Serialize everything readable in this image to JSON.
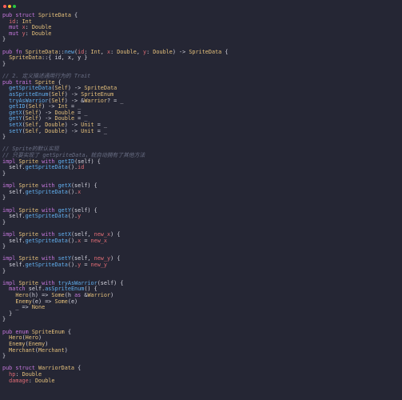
{
  "window": {
    "controls": {
      "close_color": "#ff5f57",
      "minimize_color": "#febc2e",
      "maximize_color": "#28c840"
    }
  },
  "code_lines": [
    [
      [
        "kw",
        "pub struct "
      ],
      [
        "ty",
        "SpriteData"
      ],
      [
        "pl",
        " {"
      ]
    ],
    [
      [
        "pr",
        "  id"
      ],
      [
        "pl",
        ": "
      ],
      [
        "ty",
        "Int"
      ]
    ],
    [
      [
        "kw",
        "  mut "
      ],
      [
        "pr",
        "x"
      ],
      [
        "pl",
        ": "
      ],
      [
        "ty",
        "Double"
      ]
    ],
    [
      [
        "kw",
        "  mut "
      ],
      [
        "pr",
        "y"
      ],
      [
        "pl",
        ": "
      ],
      [
        "ty",
        "Double"
      ]
    ],
    [
      [
        "pl",
        "}"
      ]
    ],
    [],
    [
      [
        "kw",
        "pub fn "
      ],
      [
        "ty",
        "SpriteData"
      ],
      [
        "pl",
        "::"
      ],
      [
        "fn",
        "new"
      ],
      [
        "pl",
        "("
      ],
      [
        "pr",
        "id"
      ],
      [
        "pl",
        ": "
      ],
      [
        "ty",
        "Int"
      ],
      [
        "pl",
        ", "
      ],
      [
        "pr",
        "x"
      ],
      [
        "pl",
        ": "
      ],
      [
        "ty",
        "Double"
      ],
      [
        "pl",
        ", "
      ],
      [
        "pr",
        "y"
      ],
      [
        "pl",
        ": "
      ],
      [
        "ty",
        "Double"
      ],
      [
        "pl",
        ") -> "
      ],
      [
        "ty",
        "SpriteData"
      ],
      [
        "pl",
        " {"
      ]
    ],
    [
      [
        "pl",
        "  "
      ],
      [
        "ty",
        "SpriteData"
      ],
      [
        "pl",
        "::{ id, x, y }"
      ]
    ],
    [
      [
        "pl",
        "}"
      ]
    ],
    [],
    [
      [
        "cm",
        "// 2. 定义描述通用行为的 Trait"
      ]
    ],
    [
      [
        "kw",
        "pub trait "
      ],
      [
        "ty",
        "Sprite"
      ],
      [
        "pl",
        " {"
      ]
    ],
    [
      [
        "fn",
        "  getSpriteData"
      ],
      [
        "pl",
        "("
      ],
      [
        "ty",
        "Self"
      ],
      [
        "pl",
        ") -> "
      ],
      [
        "ty",
        "SpriteData"
      ]
    ],
    [
      [
        "fn",
        "  asSpriteEnum"
      ],
      [
        "pl",
        "("
      ],
      [
        "ty",
        "Self"
      ],
      [
        "pl",
        ") -> "
      ],
      [
        "ty",
        "SpriteEnum"
      ]
    ],
    [
      [
        "fn",
        "  tryAsWarrior"
      ],
      [
        "pl",
        "("
      ],
      [
        "ty",
        "Self"
      ],
      [
        "pl",
        ") -> &"
      ],
      [
        "ty",
        "Warrior"
      ],
      [
        "pl",
        "? = _"
      ]
    ],
    [
      [
        "fn",
        "  getID"
      ],
      [
        "pl",
        "("
      ],
      [
        "ty",
        "Self"
      ],
      [
        "pl",
        ") -> "
      ],
      [
        "ty",
        "Int"
      ],
      [
        "pl",
        " = _"
      ]
    ],
    [
      [
        "fn",
        "  getX"
      ],
      [
        "pl",
        "("
      ],
      [
        "ty",
        "Self"
      ],
      [
        "pl",
        ") -> "
      ],
      [
        "ty",
        "Double"
      ],
      [
        "pl",
        " = _"
      ]
    ],
    [
      [
        "fn",
        "  getY"
      ],
      [
        "pl",
        "("
      ],
      [
        "ty",
        "Self"
      ],
      [
        "pl",
        ") -> "
      ],
      [
        "ty",
        "Double"
      ],
      [
        "pl",
        " = _"
      ]
    ],
    [
      [
        "fn",
        "  setX"
      ],
      [
        "pl",
        "("
      ],
      [
        "ty",
        "Self"
      ],
      [
        "pl",
        ", "
      ],
      [
        "ty",
        "Double"
      ],
      [
        "pl",
        ") -> "
      ],
      [
        "ty",
        "Unit"
      ],
      [
        "pl",
        " = _"
      ]
    ],
    [
      [
        "fn",
        "  setY"
      ],
      [
        "pl",
        "("
      ],
      [
        "ty",
        "Self"
      ],
      [
        "pl",
        ", "
      ],
      [
        "ty",
        "Double"
      ],
      [
        "pl",
        ") -> "
      ],
      [
        "ty",
        "Unit"
      ],
      [
        "pl",
        " = _"
      ]
    ],
    [
      [
        "pl",
        "}"
      ]
    ],
    [],
    [
      [
        "cm",
        "// Sprite的默认实现"
      ]
    ],
    [
      [
        "cm",
        "// 只要实现了 getSpriteData，就自动拥有了其他方法"
      ]
    ],
    [
      [
        "kw",
        "impl "
      ],
      [
        "ty",
        "Sprite"
      ],
      [
        "kw",
        " with "
      ],
      [
        "fn",
        "getID"
      ],
      [
        "pl",
        "(self) {"
      ]
    ],
    [
      [
        "pl",
        "  self."
      ],
      [
        "fn",
        "getSpriteData"
      ],
      [
        "pl",
        "()."
      ],
      [
        "pr",
        "id"
      ]
    ],
    [
      [
        "pl",
        "}"
      ]
    ],
    [],
    [
      [
        "kw",
        "impl "
      ],
      [
        "ty",
        "Sprite"
      ],
      [
        "kw",
        " with "
      ],
      [
        "fn",
        "getX"
      ],
      [
        "pl",
        "(self) {"
      ]
    ],
    [
      [
        "pl",
        "  self."
      ],
      [
        "fn",
        "getSpriteData"
      ],
      [
        "pl",
        "()."
      ],
      [
        "pr",
        "x"
      ]
    ],
    [
      [
        "pl",
        "}"
      ]
    ],
    [],
    [
      [
        "kw",
        "impl "
      ],
      [
        "ty",
        "Sprite"
      ],
      [
        "kw",
        " with "
      ],
      [
        "fn",
        "getY"
      ],
      [
        "pl",
        "(self) {"
      ]
    ],
    [
      [
        "pl",
        "  self."
      ],
      [
        "fn",
        "getSpriteData"
      ],
      [
        "pl",
        "()."
      ],
      [
        "pr",
        "y"
      ]
    ],
    [
      [
        "pl",
        "}"
      ]
    ],
    [],
    [
      [
        "kw",
        "impl "
      ],
      [
        "ty",
        "Sprite"
      ],
      [
        "kw",
        " with "
      ],
      [
        "fn",
        "setX"
      ],
      [
        "pl",
        "(self, "
      ],
      [
        "pr",
        "new_x"
      ],
      [
        "pl",
        ") {"
      ]
    ],
    [
      [
        "pl",
        "  self."
      ],
      [
        "fn",
        "getSpriteData"
      ],
      [
        "pl",
        "()."
      ],
      [
        "pr",
        "x"
      ],
      [
        "pl",
        " = "
      ],
      [
        "pr",
        "new_x"
      ]
    ],
    [
      [
        "pl",
        "}"
      ]
    ],
    [],
    [
      [
        "kw",
        "impl "
      ],
      [
        "ty",
        "Sprite"
      ],
      [
        "kw",
        " with "
      ],
      [
        "fn",
        "setY"
      ],
      [
        "pl",
        "(self, "
      ],
      [
        "pr",
        "new_y"
      ],
      [
        "pl",
        ") {"
      ]
    ],
    [
      [
        "pl",
        "  self."
      ],
      [
        "fn",
        "getSpriteData"
      ],
      [
        "pl",
        "()."
      ],
      [
        "pr",
        "y"
      ],
      [
        "pl",
        " = "
      ],
      [
        "pr",
        "new_y"
      ]
    ],
    [
      [
        "pl",
        "}"
      ]
    ],
    [],
    [
      [
        "kw",
        "impl "
      ],
      [
        "ty",
        "Sprite"
      ],
      [
        "kw",
        " with "
      ],
      [
        "fn",
        "tryAsWarrior"
      ],
      [
        "pl",
        "(self) {"
      ]
    ],
    [
      [
        "kw",
        "  match "
      ],
      [
        "pl",
        "self."
      ],
      [
        "fn",
        "asSpriteEnum"
      ],
      [
        "pl",
        "() {"
      ]
    ],
    [
      [
        "ty",
        "    Hero"
      ],
      [
        "pl",
        "(h) => "
      ],
      [
        "ty",
        "Some"
      ],
      [
        "pl",
        "(h "
      ],
      [
        "kw",
        "as"
      ],
      [
        "pl",
        " &"
      ],
      [
        "ty",
        "Warrior"
      ],
      [
        "pl",
        ")"
      ]
    ],
    [
      [
        "ty",
        "    Enemy"
      ],
      [
        "pl",
        "(e) => "
      ],
      [
        "ty",
        "Some"
      ],
      [
        "pl",
        "(e)"
      ]
    ],
    [
      [
        "pl",
        "    _ => "
      ],
      [
        "ty",
        "None"
      ]
    ],
    [
      [
        "pl",
        "  }"
      ]
    ],
    [
      [
        "pl",
        "}"
      ]
    ],
    [],
    [
      [
        "kw",
        "pub enum "
      ],
      [
        "ty",
        "SpriteEnum"
      ],
      [
        "pl",
        " {"
      ]
    ],
    [
      [
        "ty",
        "  Hero"
      ],
      [
        "pl",
        "("
      ],
      [
        "ty",
        "Hero"
      ],
      [
        "pl",
        ")"
      ]
    ],
    [
      [
        "ty",
        "  Enemy"
      ],
      [
        "pl",
        "("
      ],
      [
        "ty",
        "Enemy"
      ],
      [
        "pl",
        ")"
      ]
    ],
    [
      [
        "ty",
        "  Merchant"
      ],
      [
        "pl",
        "("
      ],
      [
        "ty",
        "Merchant"
      ],
      [
        "pl",
        ")"
      ]
    ],
    [
      [
        "pl",
        "}"
      ]
    ],
    [],
    [
      [
        "kw",
        "pub struct "
      ],
      [
        "ty",
        "WarriorData"
      ],
      [
        "pl",
        " {"
      ]
    ],
    [
      [
        "pr",
        "  hp"
      ],
      [
        "pl",
        ": "
      ],
      [
        "ty",
        "Double"
      ]
    ],
    [
      [
        "pr",
        "  damage"
      ],
      [
        "pl",
        ": "
      ],
      [
        "ty",
        "Double"
      ]
    ]
  ]
}
